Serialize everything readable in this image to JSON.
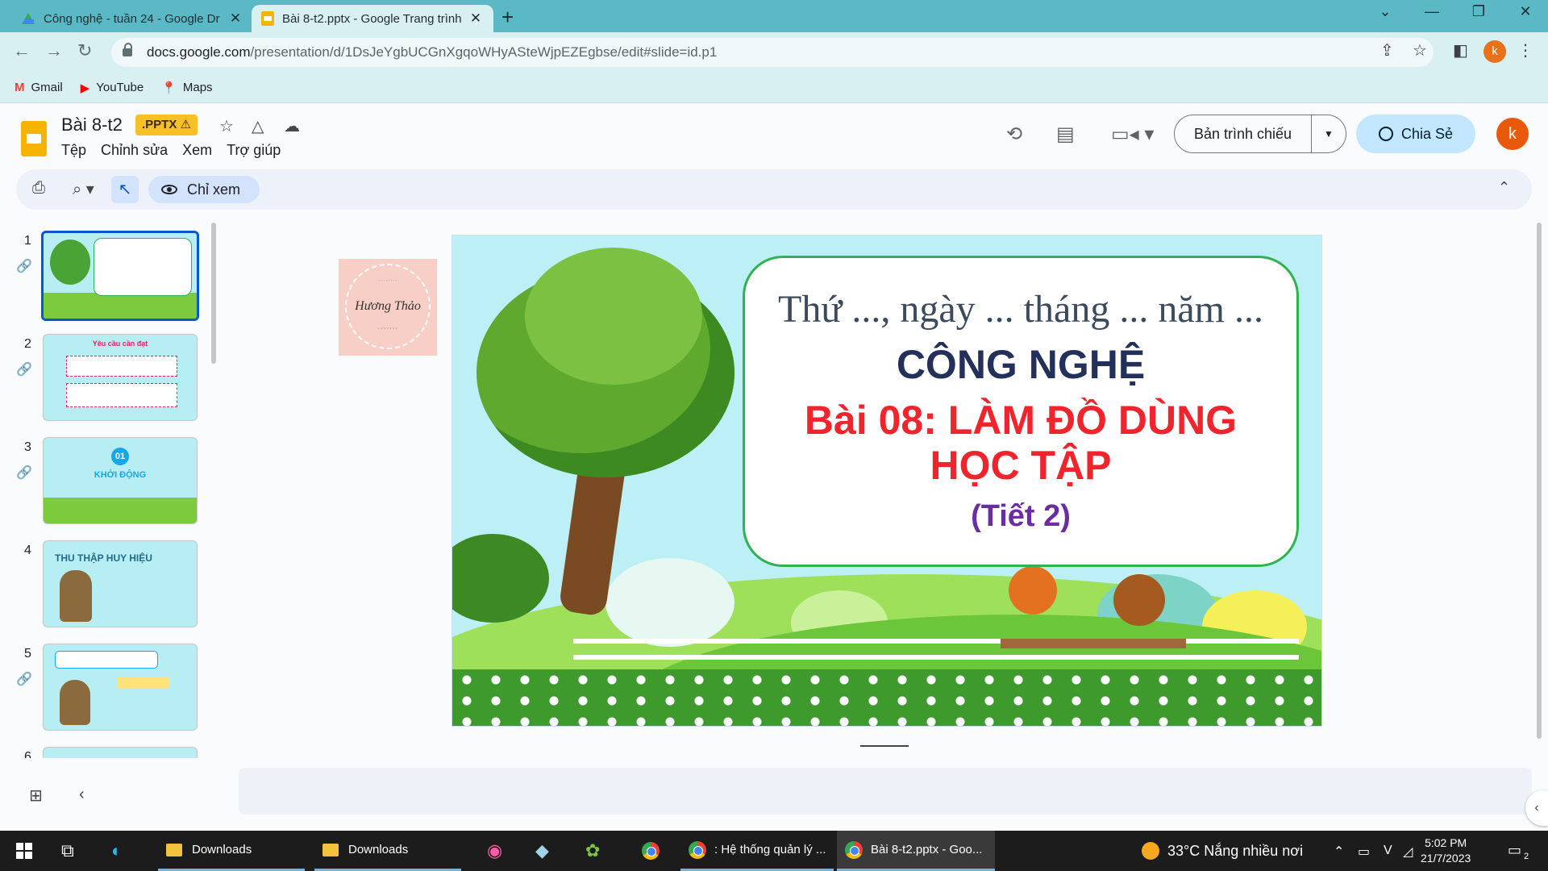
{
  "browser": {
    "tabs": [
      {
        "title": "Công nghệ - tuần 24 - Google Dr",
        "icon": "google-drive-icon",
        "active": false
      },
      {
        "title": "Bài 8-t2.pptx - Google Trang trình",
        "icon": "google-slides-icon",
        "active": true
      }
    ],
    "url_host": "docs.google.com",
    "url_path": "/presentation/d/1DsJeYgbUCGnXgqoWHyASteWjpEZEgbse/edit#slide=id.p1",
    "profile_initial": "k",
    "bookmarks": [
      {
        "label": "Gmail",
        "icon": "gmail-icon"
      },
      {
        "label": "YouTube",
        "icon": "youtube-icon"
      },
      {
        "label": "Maps",
        "icon": "maps-icon"
      }
    ]
  },
  "app": {
    "doc_title": "Bài 8-t2",
    "badge": ".PPTX",
    "menu": [
      "Tệp",
      "Chỉnh sửa",
      "Xem",
      "Trợ giúp"
    ],
    "present_label": "Bản trình chiếu",
    "share_label": "Chia Sẻ",
    "avatar_initial": "k",
    "view_mode": "Chỉ xem"
  },
  "filmstrip": {
    "slides": [
      {
        "num": "1",
        "linked": true
      },
      {
        "num": "2",
        "linked": true,
        "heading": "Yêu cầu cần đạt"
      },
      {
        "num": "3",
        "linked": true,
        "badge": "01",
        "heading": "KHỞI ĐỘNG"
      },
      {
        "num": "4",
        "linked": false,
        "heading": "THU THẬP HUY HIỆU"
      },
      {
        "num": "5",
        "linked": true
      },
      {
        "num": "6",
        "linked": false
      }
    ]
  },
  "slide": {
    "date_line": "Thứ ..., ngày ... tháng ... năm ...",
    "subject": "CÔNG NGHỆ",
    "lesson": "Bài 08: LÀM ĐỒ DÙNG HỌC TẬP",
    "period": "(Tiết 2)"
  },
  "stamp": {
    "name": "Hương Thảo"
  },
  "taskbar": {
    "items": [
      "Downloads",
      "Downloads",
      ": Hệ thống quản lý ...",
      "Bài 8-t2.pptx - Goo..."
    ],
    "weather": "33°C  Nắng nhiều nơi",
    "time": "5:02 PM",
    "date": "21/7/2023",
    "notification_count": "2"
  }
}
